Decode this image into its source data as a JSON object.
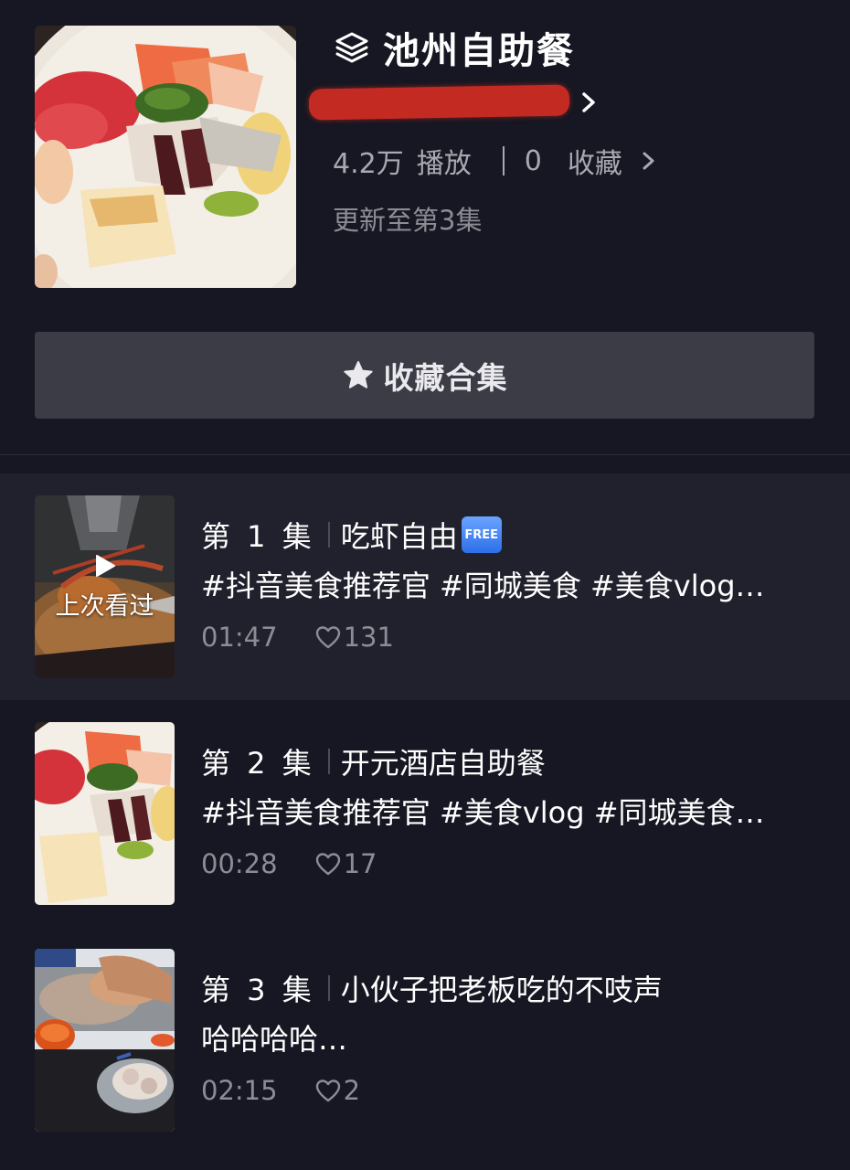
{
  "collection": {
    "title": "池州自助餐",
    "stats": {
      "plays_value": "4.2万",
      "plays_label": "播放",
      "favorites_value": "0",
      "favorites_label": "收藏"
    },
    "update_text": "更新至第3集",
    "favorite_button_label": "收藏合集"
  },
  "episodes": [
    {
      "index_label": "第 1 集",
      "title": "吃虾自由",
      "badge": "FREE",
      "tags": "#抖音美食推荐官 #同城美食 #美食vlog…",
      "duration": "01:47",
      "likes": "131",
      "overlay_label": "上次看过"
    },
    {
      "index_label": "第 2 集",
      "title": "开元酒店自助餐",
      "tags": "#抖音美食推荐官 #美食vlog #同城美食…",
      "duration": "00:28",
      "likes": "17"
    },
    {
      "index_label": "第 3 集",
      "title": "小伙子把老板吃的不吱声",
      "tags": "哈哈哈哈…",
      "duration": "02:15",
      "likes": "2"
    }
  ],
  "colors": {
    "background": "#161722",
    "active_row": "#20212c",
    "button": "#3b3c45",
    "muted_text": "#8c8d94",
    "redaction": "#c32a22",
    "free_badge": "#2d6fe8"
  },
  "icons": [
    "layers-icon",
    "chevron-right-icon",
    "star-icon",
    "heart-icon",
    "play-icon"
  ]
}
